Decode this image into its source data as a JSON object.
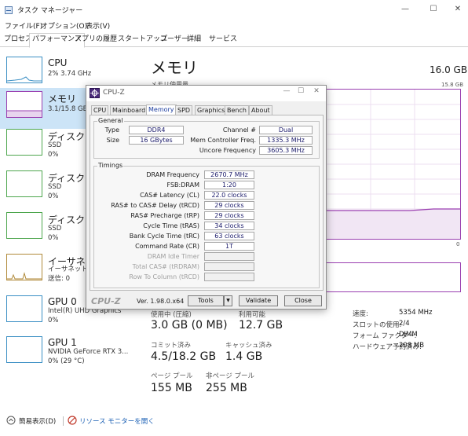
{
  "window": {
    "title": "タスク マネージャー",
    "minimize": "—",
    "maximize": "☐",
    "close": "✕"
  },
  "menu": [
    "ファイル(F)",
    "オプション(O)",
    "表示(V)"
  ],
  "tabs": [
    "プロセス",
    "パフォーマンス",
    "アプリの履歴",
    "スタートアップ",
    "ユーザー",
    "詳細",
    "サービス"
  ],
  "sidebar": {
    "items": [
      {
        "title": "CPU",
        "sub": [
          "2% 3.74 GHz"
        ]
      },
      {
        "title": "メモリ",
        "sub": [
          "3.1/15.8 GB"
        ]
      },
      {
        "title": "ディスク 0",
        "sub": [
          "SSD",
          "0%"
        ]
      },
      {
        "title": "ディスク 1",
        "sub": [
          "SSD",
          "0%"
        ]
      },
      {
        "title": "ディスク 2",
        "sub": [
          "SSD",
          "0%"
        ]
      },
      {
        "title": "イーサネット",
        "sub": [
          "イーサネット",
          "送信: 0"
        ]
      },
      {
        "title": "GPU 0",
        "sub": [
          "Intel(R) UHD Graphics",
          "0%"
        ]
      },
      {
        "title": "GPU 1",
        "sub": [
          "NVIDIA GeForce RTX 3...",
          "0% (29 °C)"
        ]
      }
    ]
  },
  "main": {
    "title": "メモリ",
    "total": "16.0 GB",
    "usage_label": "メモリ使用量",
    "max_label": "15.8 GB",
    "zero_label": "0",
    "stats": {
      "in_use_label": "使用中 (圧縮)",
      "in_use": "3.0 GB (0 MB)",
      "available_label": "利用可能",
      "available": "12.7 GB",
      "committed_label": "コミット済み",
      "committed": "4.5/18.2 GB",
      "cached_label": "キャッシュ済み",
      "cached": "1.4 GB",
      "paged_label": "ページ プール",
      "paged": "155 MB",
      "nonpaged_label": "非ページ プール",
      "nonpaged": "255 MB"
    },
    "details": [
      {
        "label": "速度:",
        "value": "5354 MHz"
      },
      {
        "label": "スロットの使用:",
        "value": "2/4"
      },
      {
        "label": "フォーム ファクター:",
        "value": "DIMM"
      },
      {
        "label": "ハードウェア予約済み:",
        "value": "208 MB"
      }
    ]
  },
  "footer": {
    "fewer_details": "簡易表示(D)",
    "resource_monitor": "リソース モニターを開く"
  },
  "cpuz": {
    "title": "CPU-Z",
    "tabs": [
      "CPU",
      "Mainboard",
      "Memory",
      "SPD",
      "Graphics",
      "Bench",
      "About"
    ],
    "general_title": "General",
    "general": {
      "type_label": "Type",
      "type": "DDR4",
      "size_label": "Size",
      "size": "16 GBytes",
      "channel_label": "Channel #",
      "channel": "Dual",
      "memctrl_label": "Mem Controller Freq.",
      "memctrl": "1335.3 MHz",
      "uncore_label": "Uncore Frequency",
      "uncore": "3605.3 MHz"
    },
    "timings_title": "Timings",
    "timings": [
      {
        "label": "DRAM Frequency",
        "value": "2670.7 MHz"
      },
      {
        "label": "FSB:DRAM",
        "value": "1:20"
      },
      {
        "label": "CAS# Latency (CL)",
        "value": "22.0 clocks"
      },
      {
        "label": "RAS# to CAS# Delay (tRCD)",
        "value": "29 clocks"
      },
      {
        "label": "RAS# Precharge (tRP)",
        "value": "29 clocks"
      },
      {
        "label": "Cycle Time (tRAS)",
        "value": "34 clocks"
      },
      {
        "label": "Bank Cycle Time (tRC)",
        "value": "63 clocks"
      },
      {
        "label": "Command Rate (CR)",
        "value": "1T"
      },
      {
        "label": "DRAM Idle Timer",
        "value": ""
      },
      {
        "label": "Total CAS# (tRDRAM)",
        "value": ""
      },
      {
        "label": "Row To Column (tRCD)",
        "value": ""
      }
    ],
    "logo": "CPU-Z",
    "version": "Ver. 1.98.0.x64",
    "tools": "Tools",
    "validate": "Validate",
    "close": "Close"
  }
}
